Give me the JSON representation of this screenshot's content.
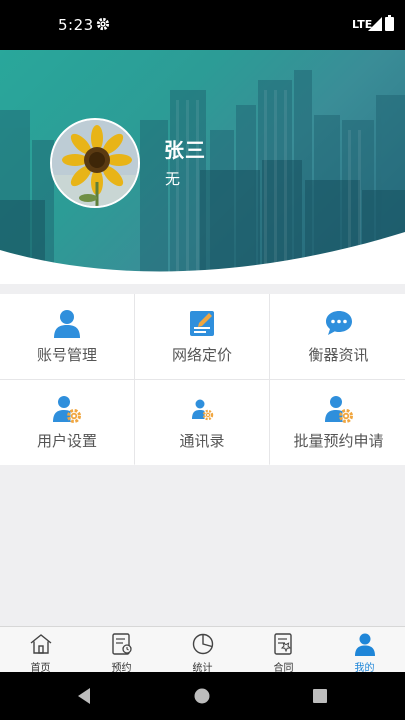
{
  "status_bar": {
    "time": "5:23",
    "network": "LTE"
  },
  "profile": {
    "name": "张三",
    "subtitle": "无"
  },
  "menu": [
    {
      "label": "账号管理",
      "icon": "person-icon"
    },
    {
      "label": "网络定价",
      "icon": "edit-note-icon"
    },
    {
      "label": "衡器资讯",
      "icon": "chat-bubble-icon"
    },
    {
      "label": "用户设置",
      "icon": "user-settings-icon"
    },
    {
      "label": "通讯录",
      "icon": "contacts-icon"
    },
    {
      "label": "批量预约申请",
      "icon": "user-gear-icon"
    }
  ],
  "tabs": [
    {
      "label": "首页",
      "icon": "home-icon",
      "active": false
    },
    {
      "label": "预约",
      "icon": "booking-icon",
      "active": false
    },
    {
      "label": "统计",
      "icon": "pie-chart-icon",
      "active": false
    },
    {
      "label": "合同",
      "icon": "contract-icon",
      "active": false
    },
    {
      "label": "我的",
      "icon": "profile-icon",
      "active": true
    }
  ],
  "colors": {
    "accent": "#1f86d8",
    "icon_blue": "#2f8fdc",
    "gear_orange": "#f0a640",
    "banner_teal": "#2c9c96"
  }
}
